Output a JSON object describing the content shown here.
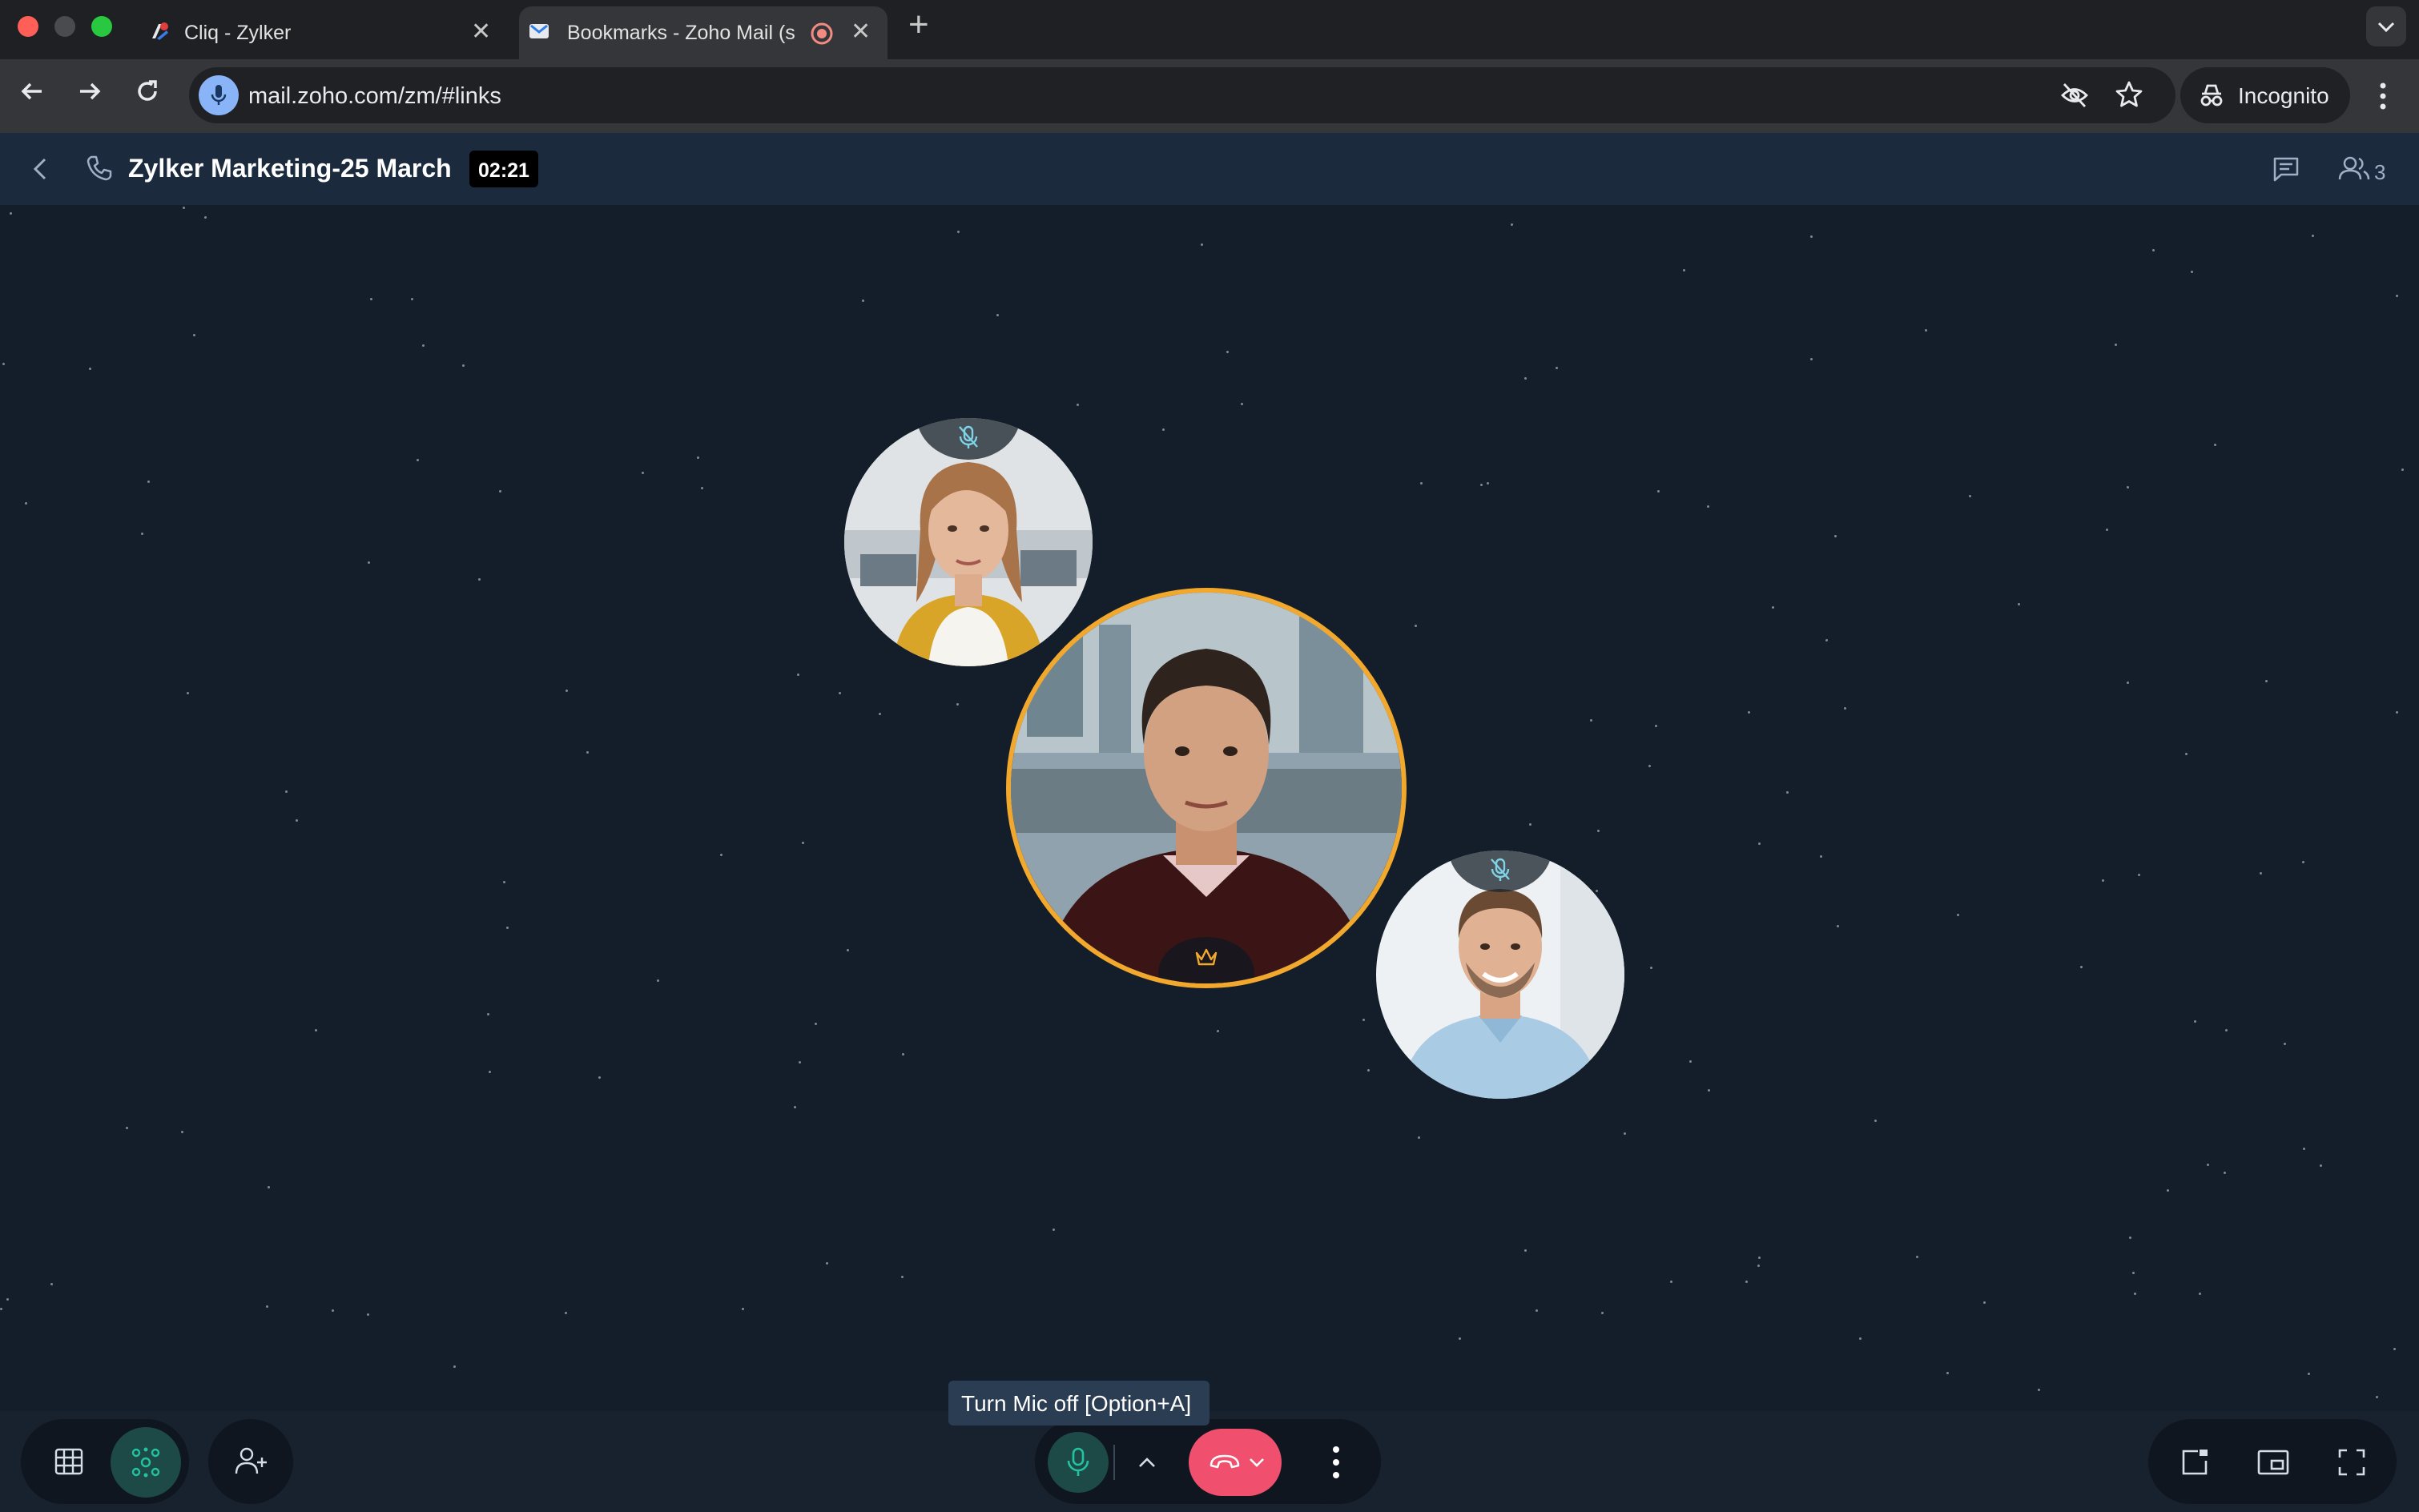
{
  "browser": {
    "tabs": [
      {
        "title": "Cliq - Zylker"
      },
      {
        "title": "Bookmarks - Zoho Mail (s"
      }
    ],
    "url": "mail.zoho.com/zm/#links",
    "incognito_label": "Incognito"
  },
  "call": {
    "title": "Zylker Marketing-25 March",
    "timer": "02:21",
    "participant_count": "3"
  },
  "participants": [
    {
      "name": "participant-woman",
      "muted": true
    },
    {
      "name": "participant-host",
      "muted": false,
      "host": true
    },
    {
      "name": "participant-man",
      "muted": true
    }
  ],
  "controls": {
    "mic_tooltip": "Turn Mic off [Option+A]"
  },
  "colors": {
    "accent_green": "#23c2a0",
    "end_call_red": "#f0506e",
    "host_ring": "#f1a82c"
  }
}
